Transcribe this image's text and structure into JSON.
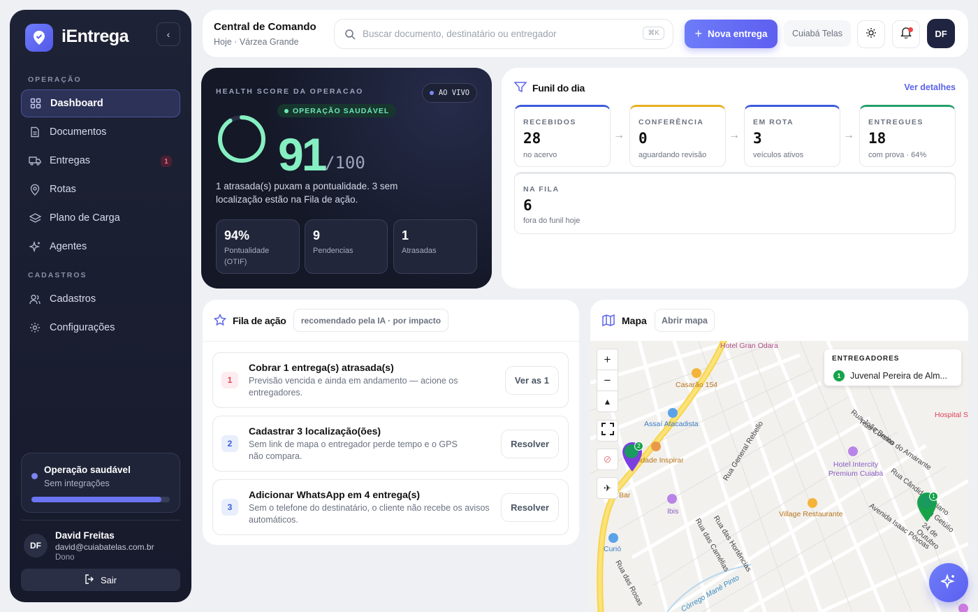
{
  "sidebar": {
    "brand": "iEntrega",
    "section_operacao": "OPERAÇÃO",
    "section_cadastros": "CADASTROS",
    "items": [
      {
        "label": "Dashboard",
        "icon": "grid-icon"
      },
      {
        "label": "Documentos",
        "icon": "document-icon"
      },
      {
        "label": "Entregas",
        "icon": "truck-icon",
        "badge": "1"
      },
      {
        "label": "Rotas",
        "icon": "map-pin-icon"
      },
      {
        "label": "Plano de Carga",
        "icon": "layers-icon"
      },
      {
        "label": "Agentes",
        "icon": "sparkle-icon"
      }
    ],
    "items2": [
      {
        "label": "Cadastros",
        "icon": "users-icon"
      },
      {
        "label": "Configurações",
        "icon": "gear-icon"
      }
    ],
    "status": {
      "title": "Operação saudável",
      "subtitle": "Sem integrações",
      "progress": 0.94
    },
    "user": {
      "initials": "DF",
      "name": "David Freitas",
      "email": "david@cuiabatelas.com.br",
      "role": "Dono"
    },
    "logout_label": "Sair"
  },
  "header": {
    "title": "Central de Comando",
    "subtitle": "Hoje · Várzea Grande",
    "search_placeholder": "Buscar documento, destinatário ou entregador",
    "search_shortcut": "⌘K",
    "new_button": "Nova entrega",
    "tenant": "Cuiabá Telas",
    "avatar_initials": "DF"
  },
  "health": {
    "label": "HEALTH SCORE DA OPERACAO",
    "live": "AO VIVO",
    "status": "OPERAÇÃO SAUDÁVEL",
    "score": "91",
    "max": "/100",
    "description": "1 atrasada(s) puxam a pontualidade. 3 sem localização estão na Fila de ação.",
    "kpis": [
      {
        "value": "94%",
        "label": "Pontualidade (OTIF)"
      },
      {
        "value": "9",
        "label": "Pendencias"
      },
      {
        "value": "1",
        "label": "Atrasadas"
      }
    ],
    "colors": {
      "accent": "#86efc1"
    }
  },
  "funnel": {
    "title": "Funil do dia",
    "link": "Ver detalhes",
    "stages": [
      {
        "title": "RECEBIDOS",
        "value": "28",
        "sub": "no acervo",
        "color": "#3b5bdb"
      },
      {
        "title": "CONFERÊNCIA",
        "value": "0",
        "sub": "aguardando revisão",
        "color": "#e5b020"
      },
      {
        "title": "EM ROTA",
        "value": "3",
        "sub": "veículos ativos",
        "color": "#3b5bdb"
      },
      {
        "title": "ENTREGUES",
        "value": "18",
        "sub": "com prova · 64%",
        "color": "#22a06b"
      }
    ],
    "queue": {
      "title": "NA FILA",
      "value": "6",
      "sub": "fora do funil hoje"
    }
  },
  "actions": {
    "title": "Fila de ação",
    "pill": "recomendado pela IA · por impacto",
    "tasks": [
      {
        "n": "1",
        "title": "Cobrar 1 entrega(s) atrasada(s)",
        "desc": "Previsão vencida e ainda em andamento — acione os entregadores.",
        "button": "Ver as 1"
      },
      {
        "n": "2",
        "title": "Cadastrar 3 localização(ões)",
        "desc": "Sem link de mapa o entregador perde tempo e o GPS não compara.",
        "button": "Resolver"
      },
      {
        "n": "3",
        "title": "Adicionar WhatsApp em 4 entrega(s)",
        "desc": "Sem o telefone do destinatário, o cliente não recebe os avisos automáticos.",
        "button": "Resolver"
      }
    ]
  },
  "map": {
    "title": "Mapa",
    "open": "Abrir mapa",
    "legend_title": "ENTREGADORES",
    "legend_item": "Juvenal Pereira de Alm...",
    "legend_num": "1",
    "labels": {
      "hotel_gran": "Hotel Gran Odara",
      "casarao": "Casarão 154",
      "assai": "Assaí Atacadista",
      "inspirar": "ldade Inspirar",
      "bar": "Bar",
      "ibis": "Ibis",
      "curio": "Curió",
      "village": "Village Restaurante",
      "intercity": "Hotel Intercity Premium Cuiabá",
      "hospital": "Hospital S",
      "corsino": "Rua Corsino do Amarante",
      "joao_bento": "Rua João Bento",
      "general": "Rua General Rebello",
      "hortencias": "Rua das Hortências",
      "camelias": "Rua das Camélias",
      "rosas": "Rua das Rosas",
      "mane": "Córrego Mané Pinto",
      "candido": "Rua Cândido Mariano",
      "isaac": "Avenida Isaac Póvoas",
      "getulio": "Rua Getúlio",
      "outubro": "24 de Outubro",
      "pin_count": "2",
      "pin2_count": "1"
    }
  }
}
